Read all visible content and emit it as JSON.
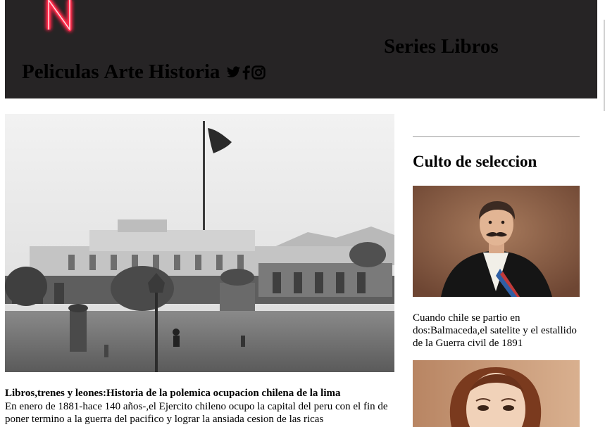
{
  "header": {
    "logo_letter": "N",
    "nav_left": [
      "Peliculas",
      "Arte",
      "Historia"
    ],
    "nav_right": [
      "Series",
      "Libros"
    ],
    "social_icons": [
      "twitter-icon",
      "facebook-icon",
      "instagram-icon"
    ]
  },
  "article": {
    "title": "Libros,trenes y leones:Historia de la polemica ocupacion chilena de la lima",
    "body": "En enero de 1881-hace 140 años-,el Ejercito chileno ocupo la capital del peru con el fin de poner termino a la guerra del pacifico y lograr la ansiada cesion de las ricas"
  },
  "sidebar": {
    "title": "Culto de seleccion",
    "caption": "Cuando chile se partio en dos:Balmaceda,el satelite y el estallido de la Guerra civil de 1891"
  },
  "colors": {
    "header_bg": "#262425",
    "neon_red": "#ff2a4a",
    "rule": "#9a9a9a"
  }
}
